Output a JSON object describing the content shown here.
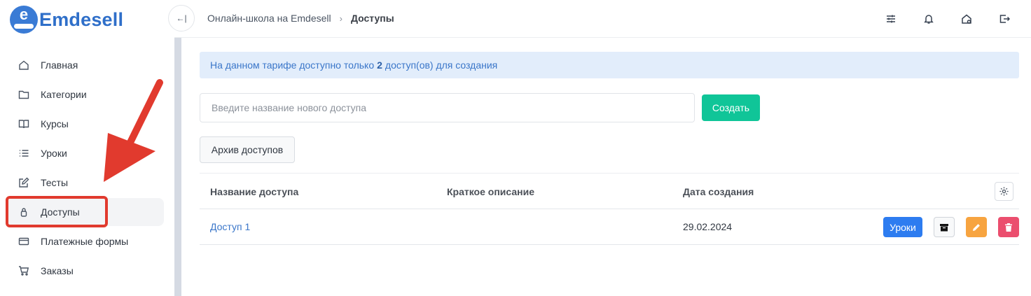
{
  "brand": {
    "name": "Emdesell",
    "logo_letter": "e",
    "color": "#2f6fc9"
  },
  "sidebar": {
    "items": [
      {
        "label": "Главная",
        "icon": "home-icon"
      },
      {
        "label": "Категории",
        "icon": "folder-icon"
      },
      {
        "label": "Курсы",
        "icon": "book-icon"
      },
      {
        "label": "Уроки",
        "icon": "list-icon"
      },
      {
        "label": "Тесты",
        "icon": "edit-icon"
      },
      {
        "label": "Доступы",
        "icon": "lock-icon",
        "active": true
      },
      {
        "label": "Платежные формы",
        "icon": "credit-card-icon"
      },
      {
        "label": "Заказы",
        "icon": "cart-icon"
      }
    ]
  },
  "header": {
    "collapse_glyph": "←|",
    "breadcrumb": {
      "parent": "Онлайн-школа на Emdesell",
      "separator": "›",
      "current": "Доступы"
    },
    "icons": [
      "sliders-icon",
      "bell-icon",
      "home-settings-icon",
      "logout-icon"
    ]
  },
  "main": {
    "alert": {
      "before": "На данном тарифе доступно только",
      "count": "2",
      "after": "доступ(ов) для создания"
    },
    "new_access": {
      "placeholder": "Введите название нового доступа",
      "value": "",
      "button": "Создать"
    },
    "archive_button": "Архив доступов",
    "table": {
      "columns": [
        "Название доступа",
        "Краткое описание",
        "Дата создания"
      ],
      "rows": [
        {
          "name": "Доступ 1",
          "description": "",
          "created": "29.02.2024",
          "lessons_button": "Уроки"
        }
      ]
    }
  },
  "colors": {
    "accent_blue": "#2d7cf0",
    "create_green": "#10c598",
    "edit_orange": "#f7a440",
    "delete_red": "#eb4e6e",
    "annotation_red": "#e13a2e"
  }
}
